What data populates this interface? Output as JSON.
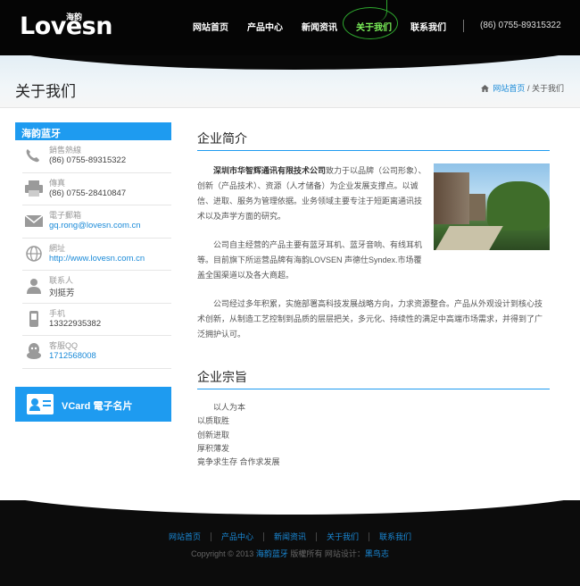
{
  "header": {
    "logo": "Lovesn",
    "logo_cn": "海韵",
    "nav": [
      {
        "label": "网站首页"
      },
      {
        "label": "产品中心"
      },
      {
        "label": "新闻资讯"
      },
      {
        "label": "关于我们",
        "active": true
      },
      {
        "label": "联系我们"
      }
    ],
    "phone": "(86) 0755-89315322"
  },
  "banner": {
    "title": "关于我们",
    "breadcrumb": {
      "home": "网站首页",
      "separator": "/",
      "current": "关于我们"
    }
  },
  "sidebar": {
    "title": "海韵蓝牙",
    "contacts": [
      {
        "icon": "phone-icon",
        "label": "銷售熱線",
        "value": "(86) 0755-89315322"
      },
      {
        "icon": "fax-icon",
        "label": "傳真",
        "value": "(86) 0755-28410847"
      },
      {
        "icon": "mail-icon",
        "label": "電子郵箱",
        "value": "gq.rong@lovesn.com.cn",
        "link": true
      },
      {
        "icon": "globe-icon",
        "label": "網址",
        "value": "http://www.lovesn.com.cn",
        "link": true
      },
      {
        "icon": "user-icon",
        "label": "联系人",
        "value": "刘挺芳"
      },
      {
        "icon": "mobile-icon",
        "label": "手机",
        "value": "13322935382"
      },
      {
        "icon": "qq-icon",
        "label": "客服QQ",
        "value": "1712568008",
        "link": true
      }
    ],
    "vcard_label": "VCard 電子名片"
  },
  "main": {
    "intro_title": "企业简介",
    "p1_company": "深圳市华智辉通讯有限技术公司",
    "p1_rest": "致力于以品牌（公司形象）、创新（产品技术）、资源（人才储备）为企业发展支撑点。以诚信、进取、服务为管理依据。业务领域主要专注于短距离通讯技术以及声学方面的研究。",
    "p2": "公司自主经营的产品主要有蓝牙耳机、蓝牙音响、有线耳机等。目前旗下所运营品牌有海韵LOVSEN 声德仕Syndex.市场覆盖全国渠道以及各大商超。",
    "p3": "公司经过多年积累，实施部署高科技发展战略方向，力求资源整合。产品从外观设计到核心技术创新，从制造工艺控制到品质的层层把关，多元化、持续性的满足中高端市场需求，并得到了广泛拥护认可。",
    "tenets_title": "企业宗旨",
    "tenets": [
      "以人为本",
      "以质取胜",
      "创新进取",
      "厚积薄发",
      "竟争求生存 合作求发展"
    ]
  },
  "footer": {
    "nav": [
      "网站首页",
      "产品中心",
      "新闻资讯",
      "关于我们",
      "联系我们"
    ],
    "copy_prefix": "Copyright © 2013",
    "copy_brand": "海韵蓝牙",
    "copy_rights": "版權所有  网站设计：",
    "copy_designer": "黑鸟志"
  },
  "colors": {
    "accent": "#1e9bf0",
    "header_bg": "#050505",
    "nav_active": "#7cf25a"
  }
}
